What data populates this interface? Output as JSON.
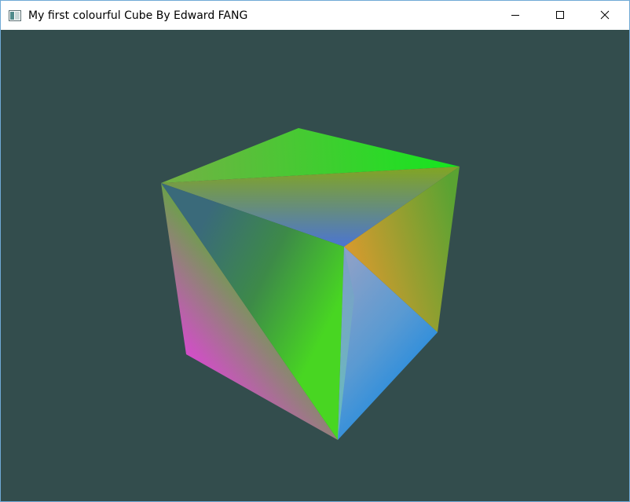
{
  "window": {
    "title": "My first colourful Cube By Edward FANG",
    "controls": {
      "minimize_icon": "minimize-icon",
      "maximize_icon": "maximize-icon",
      "close_icon": "close-icon"
    }
  },
  "viewport": {
    "background_color": "#334d4d"
  }
}
